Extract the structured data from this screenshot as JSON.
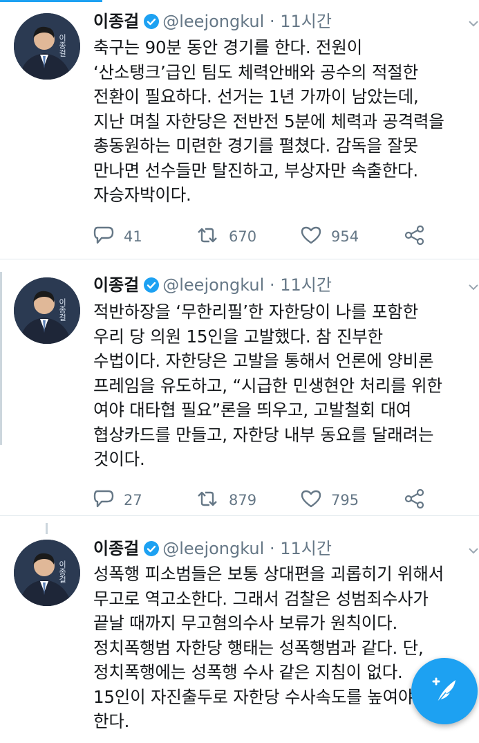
{
  "tweets": [
    {
      "author_name": "이종걸",
      "handle": "@leejongkul",
      "dot": "·",
      "time": "11시간",
      "avatar_text": "이종걸 함께",
      "text": "축구는 90분 동안 경기를 한다. 전원이\n‘산소탱크’급인 팀도 체력안배와 공수의 적절한\n전환이 필요하다. 선거는 1년 가까이 남았는데,\n지난 며칠 자한당은 전반전 5분에 체력과 공격력을\n총동원하는 미련한 경기를 펼쳤다. 감독을 잘못\n만나면 선수들만 탈진하고, 부상자만 속출한다.\n자승자박이다.",
      "replies": "41",
      "retweets": "670",
      "likes": "954"
    },
    {
      "author_name": "이종걸",
      "handle": "@leejongkul",
      "dot": "·",
      "time": "11시간",
      "avatar_text": "이종걸 함께",
      "text": "적반하장을 ‘무한리필’한 자한당이 나를 포함한\n우리 당 의원 15인을 고발했다. 참 진부한\n수법이다. 자한당은 고발을 통해서 언론에 양비론\n프레임을 유도하고, “시급한 민생현안 처리를 위한\n여야 대타협 필요”론을 띄우고, 고발철회 대여\n협상카드를 만들고, 자한당 내부 동요를 달래려는\n것이다.",
      "replies": "27",
      "retweets": "879",
      "likes": "795"
    },
    {
      "author_name": "이종걸",
      "handle": "@leejongkul",
      "dot": "·",
      "time": "11시간",
      "avatar_text": "이종걸 함께",
      "text": "성폭행 피소범들은 보통 상대편을 괴롭히기 위해서\n무고로 역고소한다. 그래서 검찰은 성범죄수사가\n끝날 때까지 무고혐의수사 보류가 원칙이다.\n정치폭행범 자한당 행태는 성폭행범과 같다. 단,\n정치폭행에는 성폭행 수사 같은 지침이 없다.\n15인이 자진출두로 자한당 수사속도를 높여야\n한다."
    }
  ],
  "compose_button": "compose-tweet",
  "colors": {
    "accent": "#1da1f2",
    "text": "#14171a",
    "muted": "#657786",
    "divider": "#e1e8ed"
  }
}
